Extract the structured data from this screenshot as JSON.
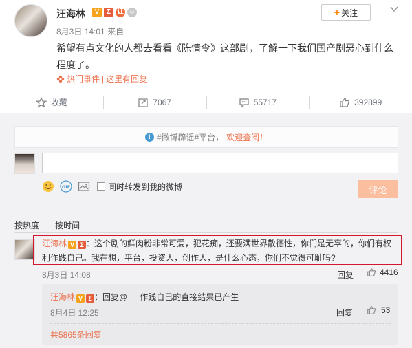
{
  "post": {
    "author": "汪海林",
    "badges": [
      "V",
      "Σ",
      "讧",
      "☺"
    ],
    "date": "8月3日 14:01",
    "source": "来自",
    "follow_label": "关注",
    "text": "希望有点文化的人都去看看《陈情令》这部剧，了解一下我们国产剧恶心到什么程度了。",
    "hot_label": "热门事件",
    "hot_sep": "|",
    "hot_link": "这里有回复"
  },
  "actions": [
    {
      "icon": "star-icon",
      "label": "收藏"
    },
    {
      "icon": "share-icon",
      "label": "7067"
    },
    {
      "icon": "comment-icon",
      "label": "55717"
    },
    {
      "icon": "thumbs-up-icon",
      "label": "392899"
    }
  ],
  "comments_section": {
    "notice_prefix": "#微博辟谣#平台，",
    "notice_emphasis": "欢迎查阅！",
    "repost_label": "同时转发到我的微博",
    "submit_label": "评论",
    "sort_hot": "按热度",
    "sort_sep": "|",
    "sort_time": "按时间"
  },
  "comment": {
    "author": "汪海林",
    "text": "：这个剧的鲜肉粉非常可爱，犯花痴，还要满世界散德性，你们是无辜的，你们有权利作践自己。我在想，平台，投资人，创作人，是什么心态，你们不觉得可耻吗?",
    "time": "8月3日 14:08",
    "reply_label": "回复",
    "likes": "4416",
    "highlight_color": "#d3182d"
  },
  "sub_reply": {
    "author": "汪海林",
    "prefix": "：回复@",
    "text": "作践自己的直接结果已产生",
    "time": "8月4日 12:25",
    "reply_label": "回复",
    "likes": "53",
    "more_label": "共5865条回复"
  },
  "colors": {
    "accent": "#eb7350",
    "follow_plus": "#ff8200",
    "submit_bg": "#fbbe9f",
    "page_bg": "#f2f2f5"
  }
}
